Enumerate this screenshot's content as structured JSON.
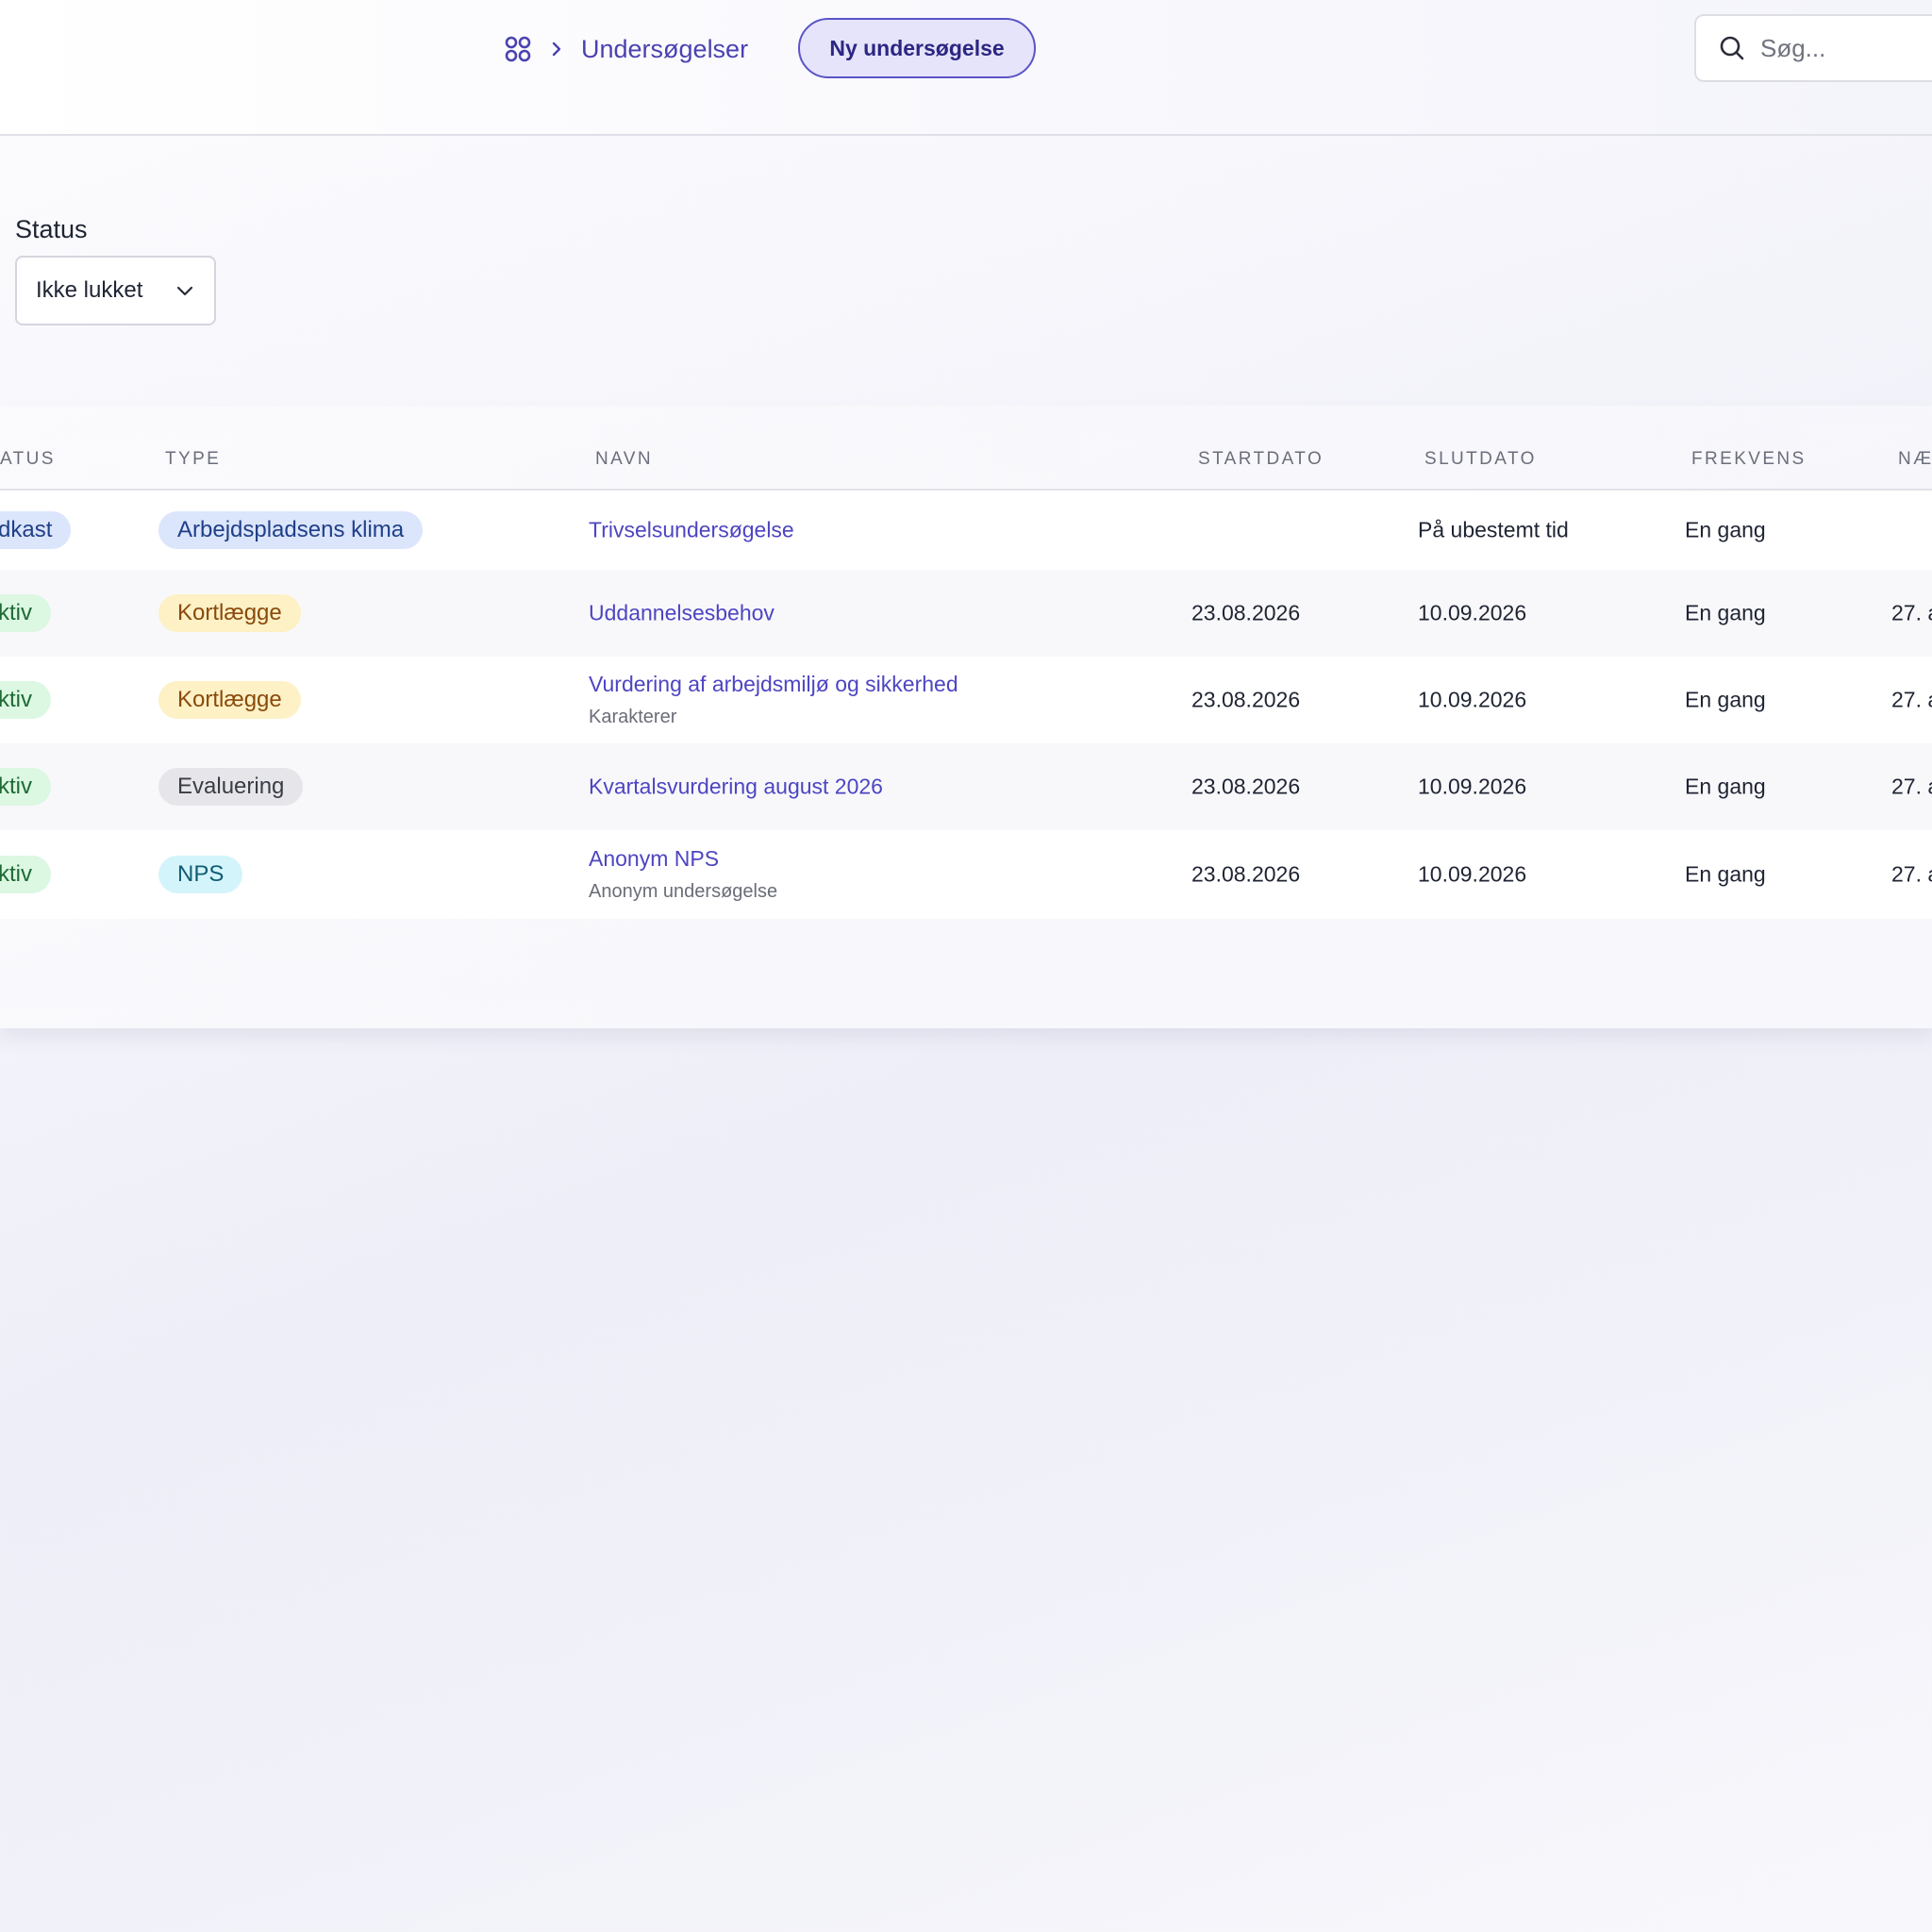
{
  "header": {
    "breadcrumb": {
      "current": "Undersøgelser"
    },
    "new_button_label": "Ny undersøgelse",
    "search": {
      "placeholder": "Søg...",
      "value": ""
    }
  },
  "filter": {
    "status_label": "Status",
    "status_value": "Ikke lukket"
  },
  "table": {
    "columns": [
      "ATUS",
      "TYPE",
      "NAVN",
      "STARTDATO",
      "SLUTDATO",
      "FREKVENS",
      "NÆ"
    ],
    "rows": [
      {
        "status": "dkast",
        "type": "Arbejdspladsens klima",
        "name": "Trivselsundersøgelse",
        "subtitle": "",
        "start": "",
        "end": "På ubestemt tid",
        "frequency": "En gang",
        "next": ""
      },
      {
        "status": "ktiv",
        "type": "Kortlægge",
        "name": "Uddannelsesbehov",
        "subtitle": "",
        "start": "23.08.2026",
        "end": "10.09.2026",
        "frequency": "En gang",
        "next": "27. a"
      },
      {
        "status": "ktiv",
        "type": "Kortlægge",
        "name": "Vurdering af arbejdsmiljø og sikkerhed",
        "subtitle": "Karakterer",
        "start": "23.08.2026",
        "end": "10.09.2026",
        "frequency": "En gang",
        "next": "27. a"
      },
      {
        "status": "ktiv",
        "type": "Evaluering",
        "name": "Kvartalsvurdering august 2026",
        "subtitle": "",
        "start": "23.08.2026",
        "end": "10.09.2026",
        "frequency": "En gang",
        "next": "27. a"
      },
      {
        "status": "ktiv",
        "type": "NPS",
        "name": "Anonym NPS",
        "subtitle": "Anonym undersøgelse",
        "start": "23.08.2026",
        "end": "10.09.2026",
        "frequency": "En gang",
        "next": "27. a"
      }
    ]
  },
  "icons": {
    "home": "grid-icon",
    "separator": "chevron-right-icon",
    "search": "search-icon",
    "select": "chevron-down-icon"
  },
  "colors": {
    "accent": "#4d45c2",
    "status_active_bg": "#dcf7e2",
    "status_draft_bg": "#dbe5fb",
    "type_blue_bg": "#dbe5fb",
    "type_yellow_bg": "#fdf1c5",
    "type_gray_bg": "#e6e6ea",
    "type_cyan_bg": "#d4f4fb"
  }
}
